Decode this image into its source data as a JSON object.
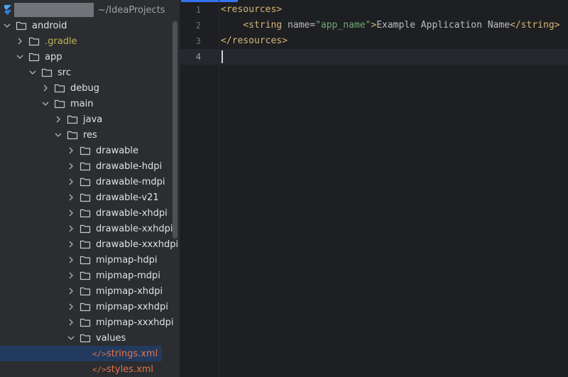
{
  "project": {
    "header_path": "~/IdeaProjects",
    "tree": [
      {
        "label": "android",
        "state": "open",
        "depth": 0,
        "kind": "folder"
      },
      {
        "label": ".gradle",
        "state": "closed",
        "depth": 1,
        "kind": "folder",
        "style": "gradle"
      },
      {
        "label": "app",
        "state": "open",
        "depth": 1,
        "kind": "folder"
      },
      {
        "label": "src",
        "state": "open",
        "depth": 2,
        "kind": "folder"
      },
      {
        "label": "debug",
        "state": "closed",
        "depth": 3,
        "kind": "folder"
      },
      {
        "label": "main",
        "state": "open",
        "depth": 3,
        "kind": "folder"
      },
      {
        "label": "java",
        "state": "closed",
        "depth": 4,
        "kind": "folder"
      },
      {
        "label": "res",
        "state": "open",
        "depth": 4,
        "kind": "folder"
      },
      {
        "label": "drawable",
        "state": "closed",
        "depth": 5,
        "kind": "folder"
      },
      {
        "label": "drawable-hdpi",
        "state": "closed",
        "depth": 5,
        "kind": "folder"
      },
      {
        "label": "drawable-mdpi",
        "state": "closed",
        "depth": 5,
        "kind": "folder"
      },
      {
        "label": "drawable-v21",
        "state": "closed",
        "depth": 5,
        "kind": "folder"
      },
      {
        "label": "drawable-xhdpi",
        "state": "closed",
        "depth": 5,
        "kind": "folder"
      },
      {
        "label": "drawable-xxhdpi",
        "state": "closed",
        "depth": 5,
        "kind": "folder"
      },
      {
        "label": "drawable-xxxhdpi",
        "state": "closed",
        "depth": 5,
        "kind": "folder"
      },
      {
        "label": "mipmap-hdpi",
        "state": "closed",
        "depth": 5,
        "kind": "folder"
      },
      {
        "label": "mipmap-mdpi",
        "state": "closed",
        "depth": 5,
        "kind": "folder"
      },
      {
        "label": "mipmap-xhdpi",
        "state": "closed",
        "depth": 5,
        "kind": "folder"
      },
      {
        "label": "mipmap-xxhdpi",
        "state": "closed",
        "depth": 5,
        "kind": "folder"
      },
      {
        "label": "mipmap-xxxhdpi",
        "state": "closed",
        "depth": 5,
        "kind": "folder"
      },
      {
        "label": "values",
        "state": "open",
        "depth": 5,
        "kind": "folder"
      },
      {
        "label": "strings.xml",
        "state": "none",
        "depth": 6,
        "kind": "xml",
        "selected": true
      },
      {
        "label": "styles.xml",
        "state": "none",
        "depth": 6,
        "kind": "xml"
      }
    ]
  },
  "editor": {
    "line_numbers": [
      "1",
      "2",
      "3",
      "4"
    ],
    "current_line": 4,
    "lines": [
      [
        {
          "t": "tag",
          "v": "<resources>"
        }
      ],
      [
        {
          "t": "txt",
          "v": "    "
        },
        {
          "t": "tag",
          "v": "<string "
        },
        {
          "t": "attr",
          "v": "name="
        },
        {
          "t": "val",
          "v": "\"app_name\""
        },
        {
          "t": "tag",
          "v": ">"
        },
        {
          "t": "txt",
          "v": "Example Application Name"
        },
        {
          "t": "tag",
          "v": "</string>"
        }
      ],
      [
        {
          "t": "tag",
          "v": "</resources>"
        }
      ],
      []
    ]
  },
  "colors": {
    "accent": "#3574f0",
    "selection": "#2e436e",
    "xml_tag": "#d5b778",
    "xml_value": "#6aab73",
    "xml_file": "#e4734c",
    "gradle_folder": "#b9b35a"
  },
  "icons": {
    "logo": "intellij-idea-logo",
    "folder": "folder-icon",
    "xml": "xml-file-icon",
    "expand": "chevron-right-icon",
    "collapse": "chevron-down-icon"
  }
}
